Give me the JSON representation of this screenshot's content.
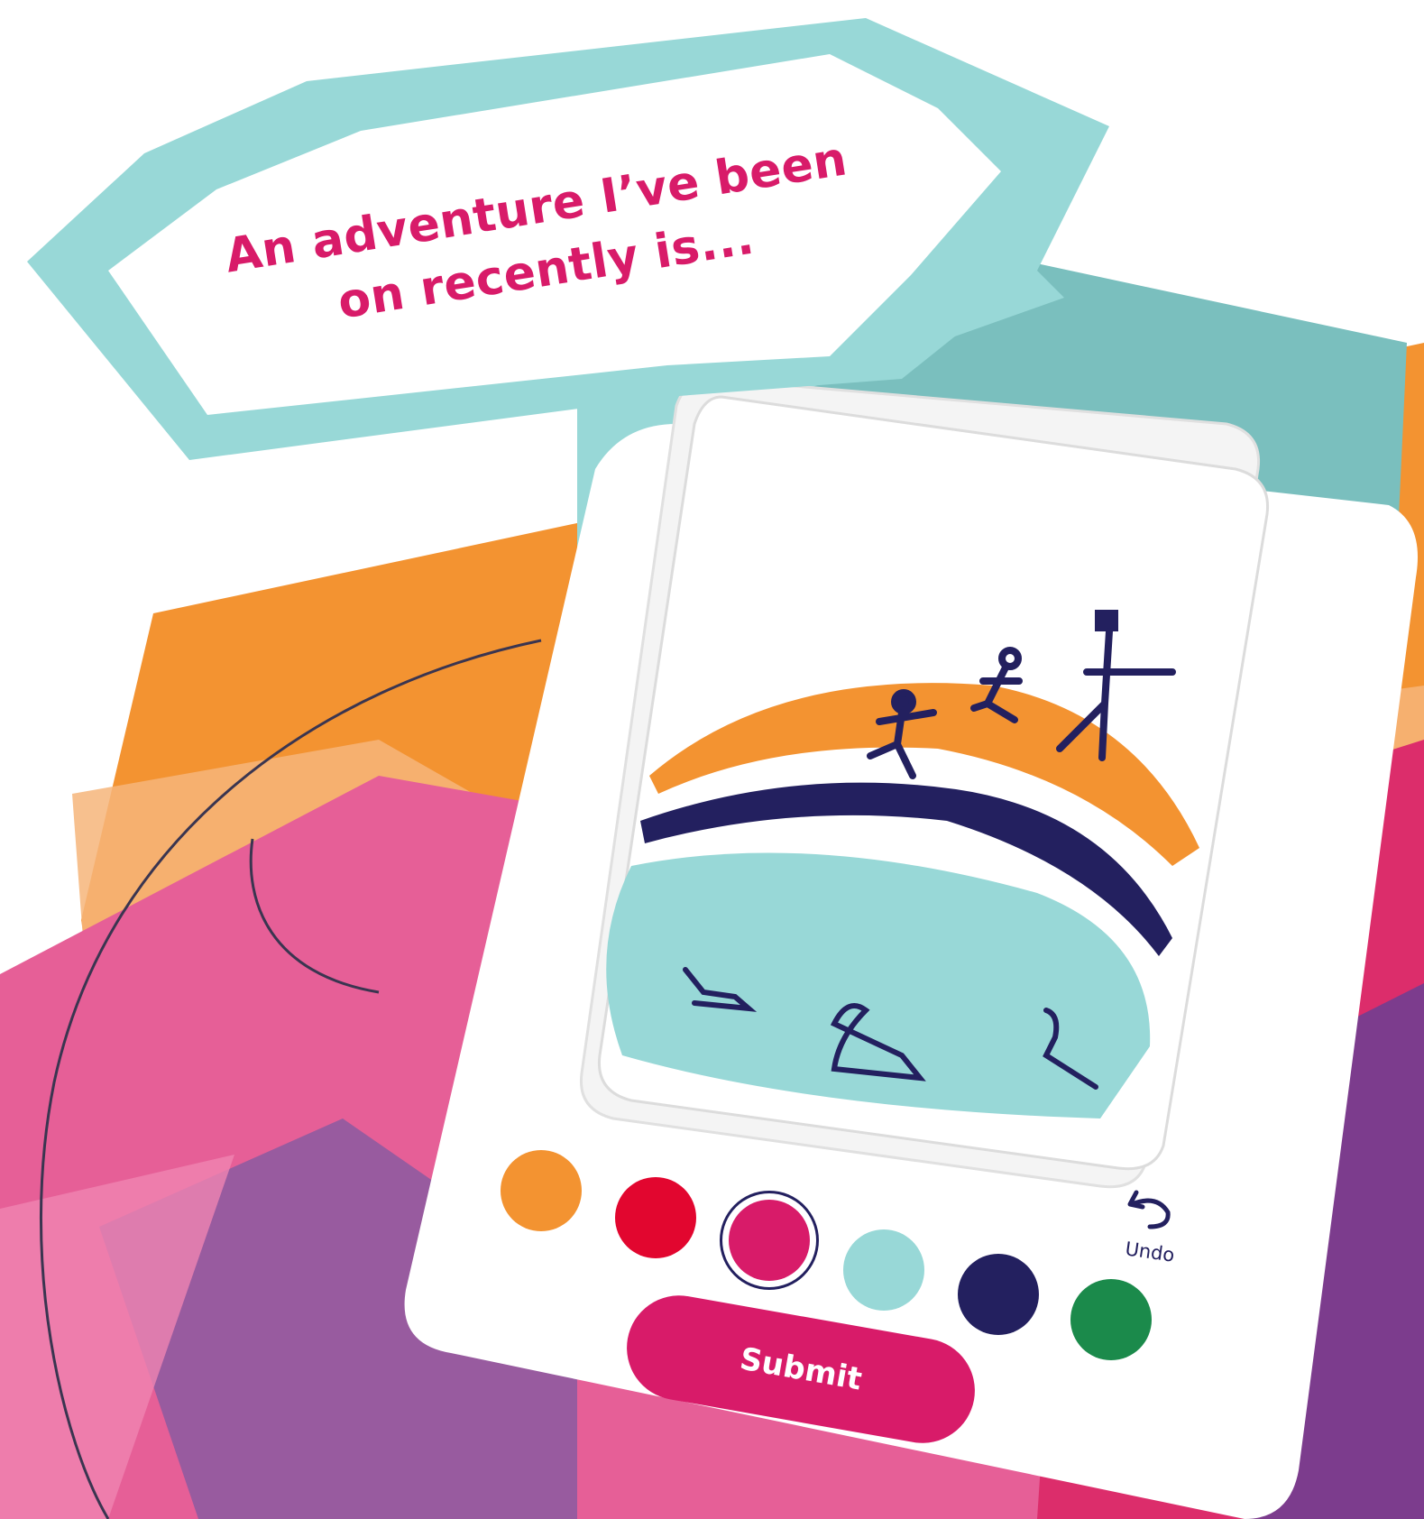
{
  "prompt": {
    "line1": "An adventure I’ve been",
    "line2": "on recently is..."
  },
  "palette": {
    "colors": [
      {
        "name": "orange",
        "hex": "#f39331"
      },
      {
        "name": "red",
        "hex": "#e2062f"
      },
      {
        "name": "magenta",
        "hex": "#d81b69"
      },
      {
        "name": "light-teal",
        "hex": "#98d8d7"
      },
      {
        "name": "navy",
        "hex": "#23205f"
      },
      {
        "name": "green",
        "hex": "#1b8a4b"
      }
    ],
    "selected": "magenta"
  },
  "undo": {
    "label": "Undo",
    "icon": "undo-arrow-icon"
  },
  "submit": {
    "label": "Submit"
  },
  "theme": {
    "accent": "#d81b69",
    "teal": "#98d8d7",
    "orange": "#f39331",
    "navy": "#23205f"
  }
}
